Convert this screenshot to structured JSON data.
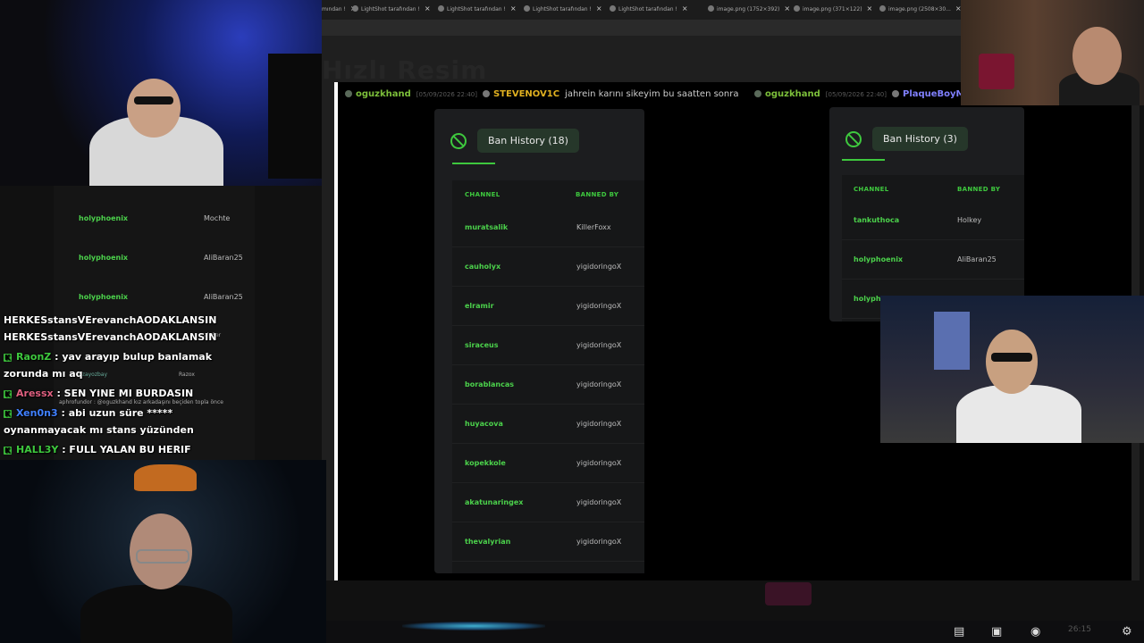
{
  "browser": {
    "tabs": [
      {
        "label": "mından !"
      },
      {
        "label": "LightShot tarafından !"
      },
      {
        "label": "LightShot tarafından !"
      },
      {
        "label": "LightShot tarafından !"
      },
      {
        "label": "LightShot tarafından !"
      },
      {
        "label": "image.png (1752×392)"
      },
      {
        "label": "image.png (371×122)"
      },
      {
        "label": "image.png (2508×30..."
      }
    ],
    "page_title": "Hızlı Resim"
  },
  "screenshot_left": {
    "message": {
      "user": "oguzkhand",
      "timestamp": "[05/09/2026 22:40]",
      "target": "STEVENOV1C",
      "text": "jahrein karını sikeyim bu saatten sonra"
    },
    "ban_button": "Ban History (18)",
    "headers": {
      "channel": "CHANNEL",
      "banned_by": "BANNED BY"
    },
    "rows": [
      {
        "channel": "muratsalik",
        "banned_by": "KillerFoxx"
      },
      {
        "channel": "cauholyx",
        "banned_by": "yigidoringoX"
      },
      {
        "channel": "elramir",
        "banned_by": "yigidoringoX"
      },
      {
        "channel": "siraceus",
        "banned_by": "yigidoringoX"
      },
      {
        "channel": "borablancas",
        "banned_by": "yigidoringoX"
      },
      {
        "channel": "huyacova",
        "banned_by": "yigidoringoX"
      },
      {
        "channel": "kopekkole",
        "banned_by": "yigidoringoX"
      },
      {
        "channel": "akatunaringex",
        "banned_by": "yigidoringoX"
      },
      {
        "channel": "thevalyrian",
        "banned_by": "yigidoringoX"
      }
    ]
  },
  "screenshot_right": {
    "message": {
      "user": "oguzkhand",
      "timestamp": "[05/09/2026 22:40]",
      "target": "PlaqueBoyMe"
    },
    "ban_button": "Ban History (3)",
    "headers": {
      "channel": "CHANNEL",
      "banned_by": "BANNED BY"
    },
    "rows": [
      {
        "channel": "tankuthoca",
        "banned_by": "Holkey"
      },
      {
        "channel": "holyphoenix",
        "banned_by": "AliBaran25"
      },
      {
        "channel": "holyph",
        "banned_by": ""
      }
    ]
  },
  "chat_background_rows": [
    {
      "a": "holyphoenix",
      "b": "Mochte"
    },
    {
      "a": "holyphoenix",
      "b": "AliBaran25"
    },
    {
      "a": "holyphoenix",
      "b": "AliBaran25"
    }
  ],
  "chat": {
    "lines": [
      {
        "badge": false,
        "user": "",
        "text": "HERKESstansVErevanchAODAKLANSIN"
      },
      {
        "badge": false,
        "user": "",
        "text": "HERKESstansVErevanchAODAKLANSIN"
      },
      {
        "badge": true,
        "user": "RaonZ",
        "user_color": "#3ec83e",
        "text": ": yav arayıp bulup banlamak"
      },
      {
        "badge": false,
        "user": "",
        "text": "zorunda mı aq"
      },
      {
        "badge": true,
        "user": "Aressx",
        "user_color": "#e06080",
        "text": ": SEN YINE MI BURDASIN"
      },
      {
        "badge": true,
        "user": "Xen0n3",
        "user_color": "#4080ff",
        "text": ": abi uzun süre *****"
      },
      {
        "badge": false,
        "user": "",
        "text": "oynanmayacak mı stans yüzünden"
      },
      {
        "badge": true,
        "user": "HALL3Y",
        "user_color": "#3ec83e",
        "text": ": FULL YALAN BU HERIF"
      }
    ],
    "small_notes": [
      "aphrofundor : @oguzkhand kız arkadaşını beçiden topla önce",
      "uzayozbay",
      "Razox",
      "alpSer"
    ]
  },
  "taskbar": {
    "clock": "26:15",
    "icons": [
      "chat-icon",
      "screen-icon",
      "mic-icon",
      "settings-icon"
    ]
  }
}
